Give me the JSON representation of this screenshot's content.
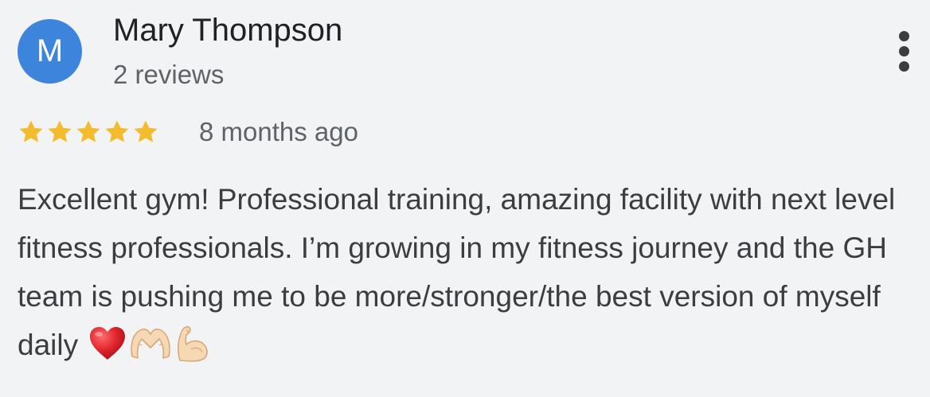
{
  "reviewer": {
    "initial": "M",
    "name": "Mary Thompson",
    "review_count": "2 reviews",
    "avatar_color": "#3d84dc"
  },
  "actions": {
    "more_icon": "more-vert-icon",
    "icon_color": "#3c3d40"
  },
  "review": {
    "rating": 5,
    "max_rating": 5,
    "star_color": "#f4bc2d",
    "star_icon": "star-icon",
    "date": "8 months ago",
    "text": "Excellent gym! Professional training, amazing facility with next level fitness professionals. I’m growing in my fitness journey and the GH team is pushing me to be more/stronger/the best version of myself daily",
    "emojis": [
      "red-heart-emoji",
      "heart-hands-emoji",
      "flexed-biceps-emoji"
    ]
  }
}
